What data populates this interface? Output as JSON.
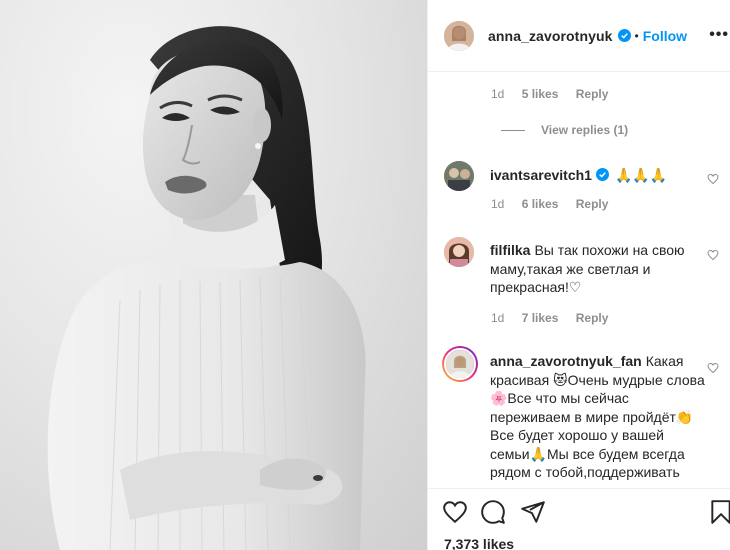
{
  "post": {
    "author": "anna_zavorotnyuk",
    "follow_label": "Follow",
    "separator": "•",
    "more_label": "•••"
  },
  "comments_section": {
    "first_meta": {
      "age": "1d",
      "likes": "5 likes",
      "reply": "Reply"
    },
    "view_replies": "View replies (1)",
    "items": [
      {
        "username": "ivantsarevitch1",
        "text": "🙏🙏🙏",
        "age": "1d",
        "likes": "6 likes",
        "reply": "Reply"
      },
      {
        "username": "filfilka",
        "text": "Вы так похожи на свою маму,такая же светлая и прекрасная!♡",
        "age": "1d",
        "likes": "7 likes",
        "reply": "Reply"
      },
      {
        "username": "anna_zavorotnyuk_fan",
        "text": "Какая красивая 😻Очень мудрые слова🌸Все что мы сейчас переживаем в мире пройдёт👏Все будет хорошо у вашей семьи🙏Мы все будем всегда рядом с тобой,поддерживать"
      }
    ]
  },
  "footer": {
    "likes_count": "7,373 likes"
  },
  "colors": {
    "accent": "#0095f6",
    "muted": "#8e8e8e",
    "text": "#262626",
    "border": "#efefef"
  }
}
